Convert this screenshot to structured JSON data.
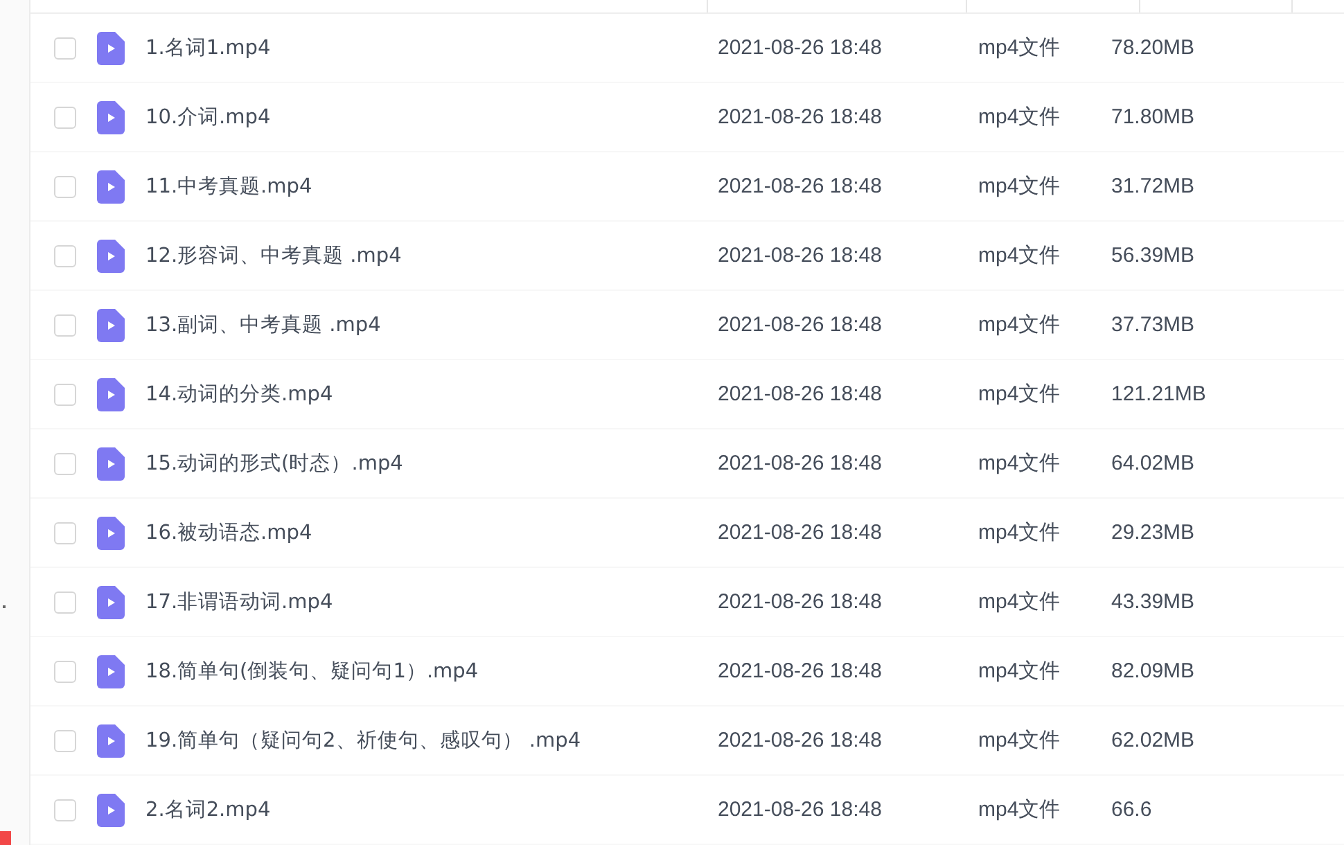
{
  "files": [
    {
      "name": "1.名词1.mp4",
      "modified": "2021-08-26 18:48",
      "type": "mp4文件",
      "size": "78.20MB",
      "selected": false
    },
    {
      "name": "10.介词.mp4",
      "modified": "2021-08-26 18:48",
      "type": "mp4文件",
      "size": "71.80MB",
      "selected": false
    },
    {
      "name": "11.中考真题.mp4",
      "modified": "2021-08-26 18:48",
      "type": "mp4文件",
      "size": "31.72MB",
      "selected": false
    },
    {
      "name": "12.形容词、中考真题  .mp4",
      "modified": "2021-08-26 18:48",
      "type": "mp4文件",
      "size": "56.39MB",
      "selected": false
    },
    {
      "name": "13.副词、中考真题  .mp4",
      "modified": "2021-08-26 18:48",
      "type": "mp4文件",
      "size": "37.73MB",
      "selected": false
    },
    {
      "name": "14.动词的分类.mp4",
      "modified": "2021-08-26 18:48",
      "type": "mp4文件",
      "size": "121.21MB",
      "selected": false
    },
    {
      "name": "15.动词的形式(时态）.mp4",
      "modified": "2021-08-26 18:48",
      "type": "mp4文件",
      "size": "64.02MB",
      "selected": false
    },
    {
      "name": "16.被动语态.mp4",
      "modified": "2021-08-26 18:48",
      "type": "mp4文件",
      "size": "29.23MB",
      "selected": false
    },
    {
      "name": "17.非谓语动词.mp4",
      "modified": "2021-08-26 18:48",
      "type": "mp4文件",
      "size": "43.39MB",
      "selected": false
    },
    {
      "name": "18.简单句(倒装句、疑问句1）.mp4",
      "modified": "2021-08-26 18:48",
      "type": "mp4文件",
      "size": "82.09MB",
      "selected": false
    },
    {
      "name": "19.简单句（疑问句2、祈使句、感叹句）  .mp4",
      "modified": "2021-08-26 18:48",
      "type": "mp4文件",
      "size": "62.02MB",
      "selected": false
    },
    {
      "name": "2.名词2.mp4",
      "modified": "2021-08-26 18:48",
      "type": "mp4文件",
      "size": "66.6",
      "selected": false
    }
  ]
}
